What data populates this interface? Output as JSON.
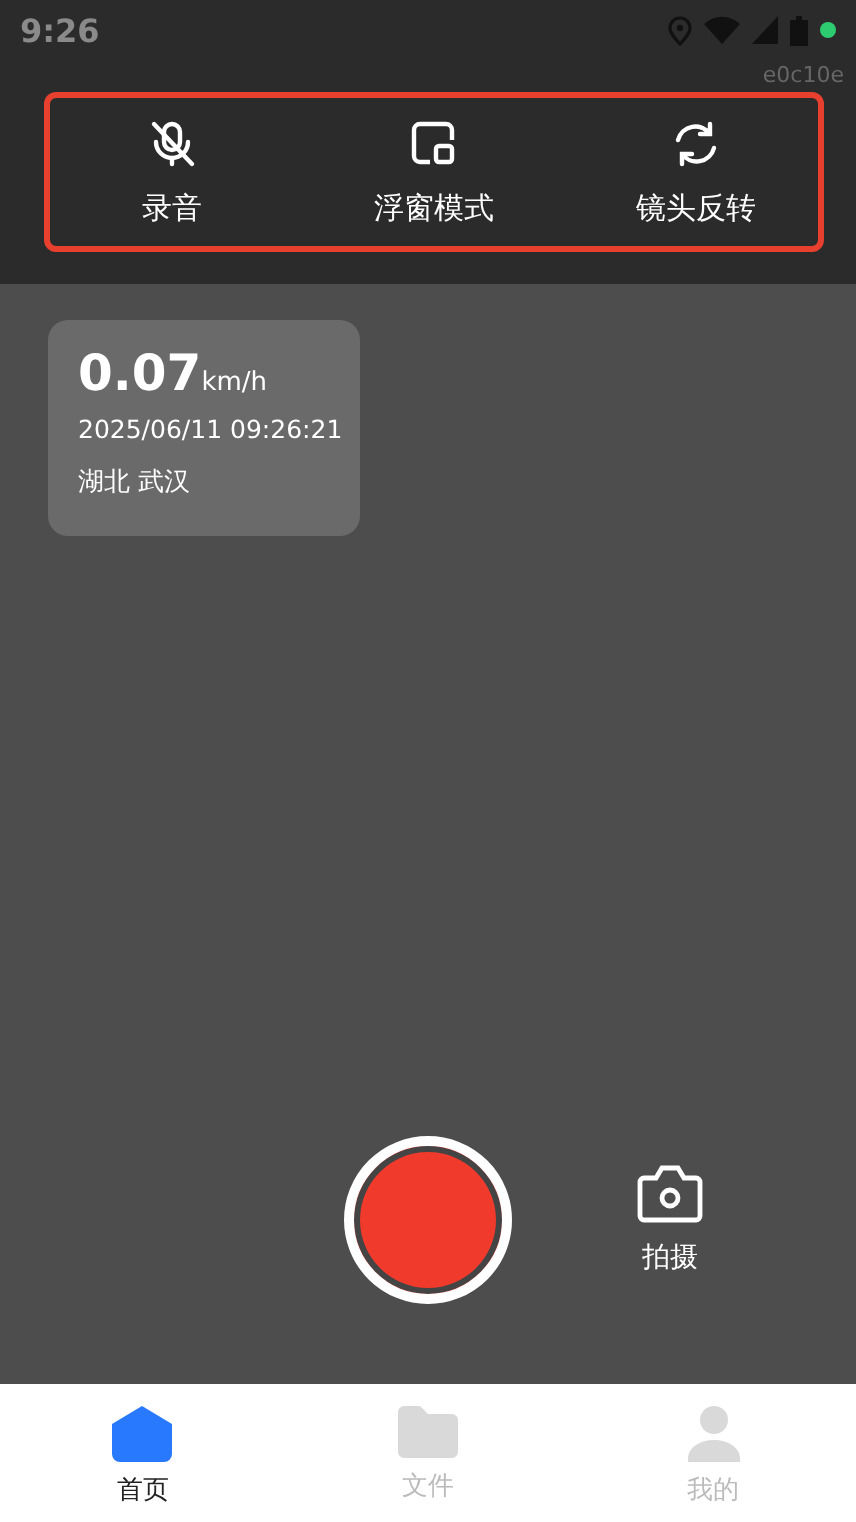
{
  "status_bar": {
    "time": "9:26"
  },
  "device_code": "e0c10e",
  "toolbar": [
    {
      "kind": "mic-off",
      "label": "录音"
    },
    {
      "kind": "float",
      "label": "浮窗模式"
    },
    {
      "kind": "flip",
      "label": "镜头反转"
    }
  ],
  "info_card": {
    "speed": "0.07",
    "unit": "km/h",
    "datetime": "2025/06/11 09:26:21",
    "location": "湖北 武汉"
  },
  "capture": {
    "label": "拍摄"
  },
  "tabs": [
    {
      "kind": "home",
      "label": "首页",
      "selected": true
    },
    {
      "kind": "files",
      "label": "文件",
      "selected": false
    },
    {
      "kind": "profile",
      "label": "我的",
      "selected": false
    }
  ]
}
